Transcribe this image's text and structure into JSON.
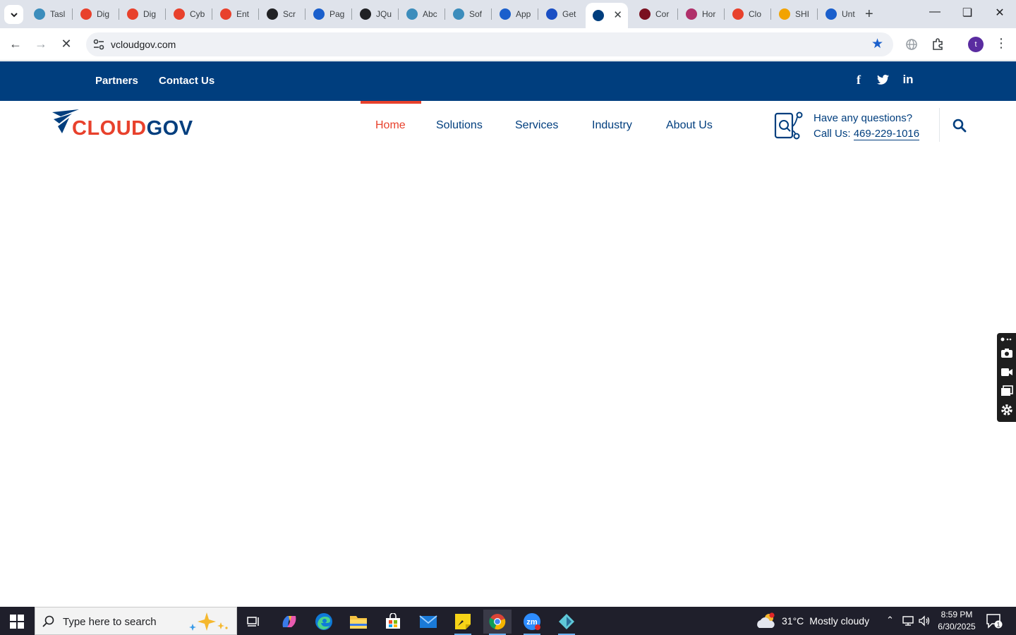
{
  "browser": {
    "tabs": [
      {
        "title": "Tasl",
        "color": "#3c8dbc"
      },
      {
        "title": "Dig",
        "color": "#e8412c"
      },
      {
        "title": "Dig",
        "color": "#e8412c"
      },
      {
        "title": "Cyb",
        "color": "#e8412c"
      },
      {
        "title": "Ent",
        "color": "#e8412c"
      },
      {
        "title": "Scr",
        "color": "#202124"
      },
      {
        "title": "Pag",
        "color": "#1a5fcc"
      },
      {
        "title": "JQu",
        "color": "#202124"
      },
      {
        "title": "Abc",
        "color": "#3c8dbc"
      },
      {
        "title": "Sof",
        "color": "#3c8dbc"
      },
      {
        "title": "App",
        "color": "#1a5fcc"
      },
      {
        "title": "Get",
        "color": "#1a4fc4"
      },
      {
        "title": "",
        "color": "#003e7e",
        "active": true
      },
      {
        "title": "Cor",
        "color": "#7a1020"
      },
      {
        "title": "Hor",
        "color": "#b0306a"
      },
      {
        "title": "Clo",
        "color": "#e8412c"
      },
      {
        "title": "SHI",
        "color": "#f2a300"
      },
      {
        "title": "Unt",
        "color": "#1a5fcc"
      }
    ],
    "url": "vcloudgov.com",
    "profile_initial": "t"
  },
  "site": {
    "top_links": [
      "Partners",
      "Contact Us"
    ],
    "social": [
      "f",
      "t",
      "in"
    ],
    "logo": {
      "part1": "CLOUD",
      "part2": "GOV"
    },
    "menu": [
      "Home",
      "Solutions",
      "Services",
      "Industry",
      "About Us"
    ],
    "active_menu": "Home",
    "contact": {
      "question": "Have any questions?",
      "call_label": "Call Us: ",
      "phone": "469-229-1016"
    }
  },
  "taskbar": {
    "search_placeholder": "Type here to search",
    "weather": {
      "temp": "31°C",
      "condition": "Mostly cloudy"
    },
    "clock": {
      "time": "8:59 PM",
      "date": "6/30/2025"
    },
    "notifications": "1"
  },
  "colors": {
    "brand_navy": "#003e7e",
    "brand_red": "#e8412c",
    "taskbar_bg": "#1f1f2b"
  }
}
